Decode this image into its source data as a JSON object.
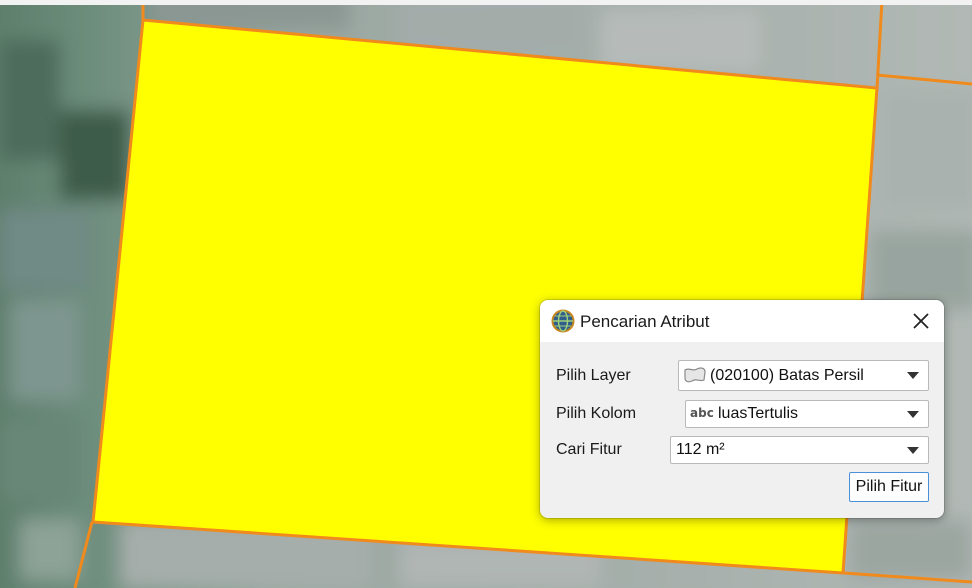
{
  "dialog": {
    "title": "Pencarian Atribut",
    "icons": {
      "app": "globe-app-icon",
      "close": "close-icon",
      "layer_type": "polygon-layer-icon",
      "field_type": "text-field-icon",
      "dropdown": "chevron-down-icon"
    },
    "layer": {
      "label": "Pilih Layer",
      "value": "(020100) Batas Persil"
    },
    "column": {
      "label": "Pilih Kolom",
      "type_badge": "abc",
      "value": "luasTertulis"
    },
    "feature": {
      "label": "Cari Fitur",
      "value": "112 m²"
    },
    "select_button": "Pilih Fitur"
  },
  "map": {
    "highlight_fill": "#ffff00",
    "boundary_color": "#f08a1c",
    "imagery": "satellite aerial imagery"
  }
}
